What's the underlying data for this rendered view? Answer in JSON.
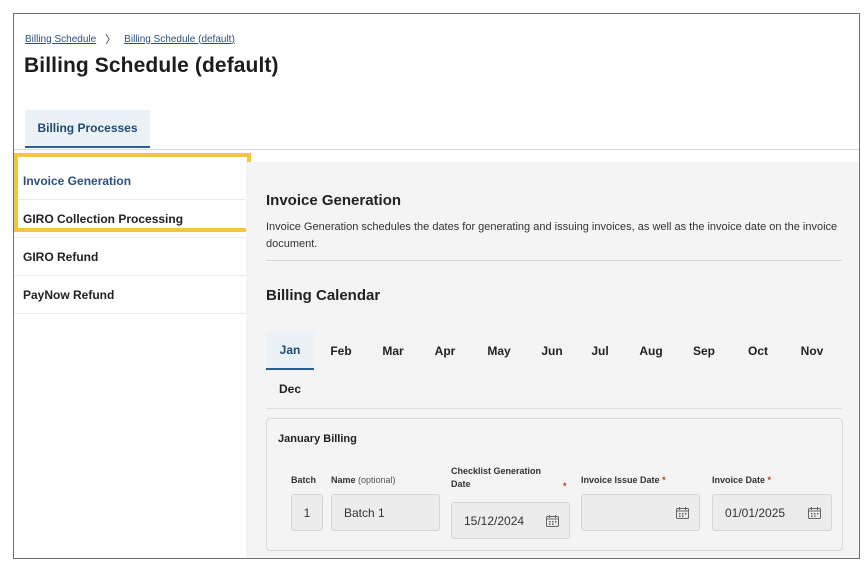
{
  "breadcrumb": {
    "items": [
      "Billing Schedule",
      "Billing Schedule (default)"
    ],
    "separator": "〉"
  },
  "page": {
    "title": "Billing Schedule (default)"
  },
  "tabs": [
    {
      "label": "Billing Processes",
      "active": true
    }
  ],
  "sidebar": {
    "items": [
      {
        "label": "Invoice Generation",
        "active": true
      },
      {
        "label": "GIRO Collection Processing",
        "active": false
      },
      {
        "label": "GIRO Refund",
        "active": false
      },
      {
        "label": "PayNow Refund",
        "active": false
      }
    ]
  },
  "section": {
    "title": "Invoice Generation",
    "description": "Invoice Generation schedules the dates for generating and issuing invoices, as well as the invoice date on the invoice document."
  },
  "calendar": {
    "title": "Billing Calendar",
    "months": [
      "Jan",
      "Feb",
      "Mar",
      "Apr",
      "May",
      "Jun",
      "Jul",
      "Aug",
      "Sep",
      "Oct",
      "Nov",
      "Dec"
    ],
    "active_month": "Jan"
  },
  "card": {
    "title": "January Billing",
    "labels": {
      "batch": "Batch",
      "name": "Name",
      "name_optional": "(optional)",
      "checklist_line1": "Checklist Generation",
      "checklist_line2": "Date",
      "issue": "Invoice Issue Date",
      "invoice": "Invoice Date",
      "required_mark": "*"
    },
    "row": {
      "batch": "1",
      "name": "Batch 1",
      "checklist_date": "15/12/2024",
      "issue_date": "",
      "invoice_date": "01/01/2025"
    }
  },
  "colors": {
    "accent": "#2c4f7c",
    "highlight": "#f4c542",
    "required": "#c0392b",
    "tab_bg": "#eaf2f8"
  },
  "icons": [
    "calendar-icon",
    "chevron-right-icon"
  ]
}
